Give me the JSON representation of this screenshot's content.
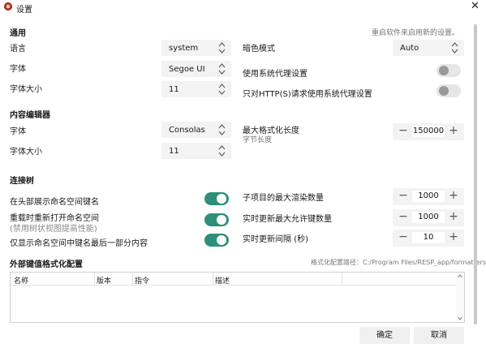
{
  "window": {
    "title": "设置",
    "close": "✕"
  },
  "general": {
    "heading": "通用",
    "restart_hint": "重启软件来启用新的设置。",
    "language": {
      "label": "语言",
      "value": "system"
    },
    "font": {
      "label": "字体",
      "value": "Segoe UI"
    },
    "font_size": {
      "label": "字体大小",
      "value": "11"
    },
    "dark_mode": {
      "label": "暗色模式",
      "value": "Auto"
    },
    "use_system_proxy": {
      "label": "使用系统代理设置",
      "on": false
    },
    "http_only_proxy": {
      "label": "只对HTTP(S)请求使用系统代理设置",
      "on": false
    }
  },
  "editor": {
    "heading": "内容编辑器",
    "font": {
      "label": "字体",
      "value": "Consolas"
    },
    "font_size": {
      "label": "字体大小",
      "value": "11"
    },
    "max_format_length": {
      "label": "最大格式化长度",
      "sub": "字节长度",
      "value": "150000"
    }
  },
  "tree": {
    "heading": "连接树",
    "show_ns_in_header": {
      "label": "在头部展示命名空间键名",
      "on": true
    },
    "reopen_ns_on_reload": {
      "label": "重载时重新打开命名空间",
      "sub": "(禁用树状视图提高性能)",
      "on": true
    },
    "show_last_part_only": {
      "label": "仅显示命名空间中键名最后一部分内容",
      "on": true
    },
    "max_children": {
      "label": "子项目的最大渲染数量",
      "value": "1000"
    },
    "max_live_keys": {
      "label": "实时更新最大允许键数量",
      "value": "1000"
    },
    "live_interval": {
      "label": "实时更新间隔 (秒)",
      "value": "10"
    }
  },
  "formatters": {
    "heading": "外部键值格式化配置",
    "path_label": "格式化配置路径：C:/Program Files/RESP_app/formatters",
    "columns": [
      "名称",
      "版本",
      "指令",
      "描述"
    ]
  },
  "buttons": {
    "ok": "确定",
    "cancel": "取消"
  },
  "colors": {
    "accent": "#2d8f7b",
    "app_icon": "#c0392b"
  },
  "icons": {
    "minus": "−",
    "plus": "+"
  }
}
